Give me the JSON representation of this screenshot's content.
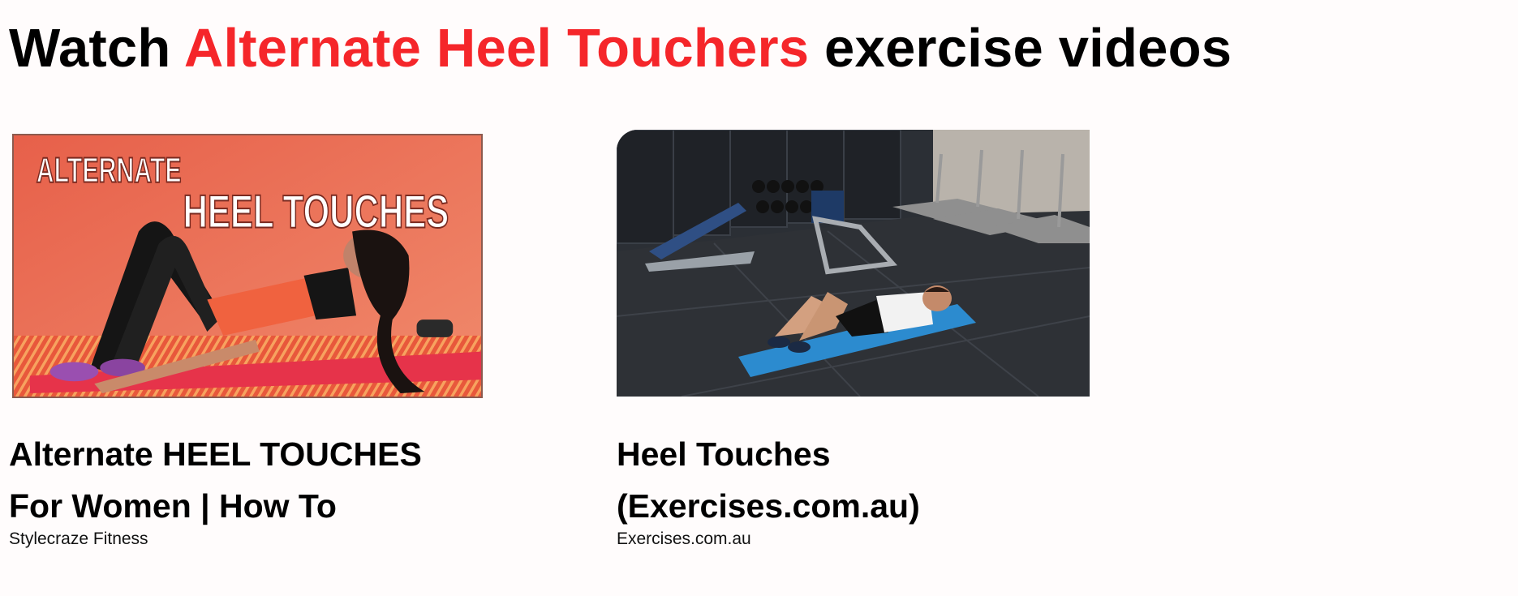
{
  "heading": {
    "prefix": "Watch",
    "exercise_name": "Alternate Heel Touchers",
    "suffix": "exercise videos"
  },
  "colors": {
    "accent": "#f5262a",
    "background": "#fffcfc",
    "text": "#000000"
  },
  "videos": [
    {
      "thumbnail_text_line1": "ALTERNATE",
      "thumbnail_text_line2": "HEEL TOUCHES",
      "title_line1": "Alternate HEEL TOUCHES",
      "title_line2": "For Women | How To",
      "channel": "Stylecraze Fitness"
    },
    {
      "title_line1": "Heel Touches",
      "title_line2": "(Exercises.com.au)",
      "channel": "Exercises.com.au"
    }
  ]
}
